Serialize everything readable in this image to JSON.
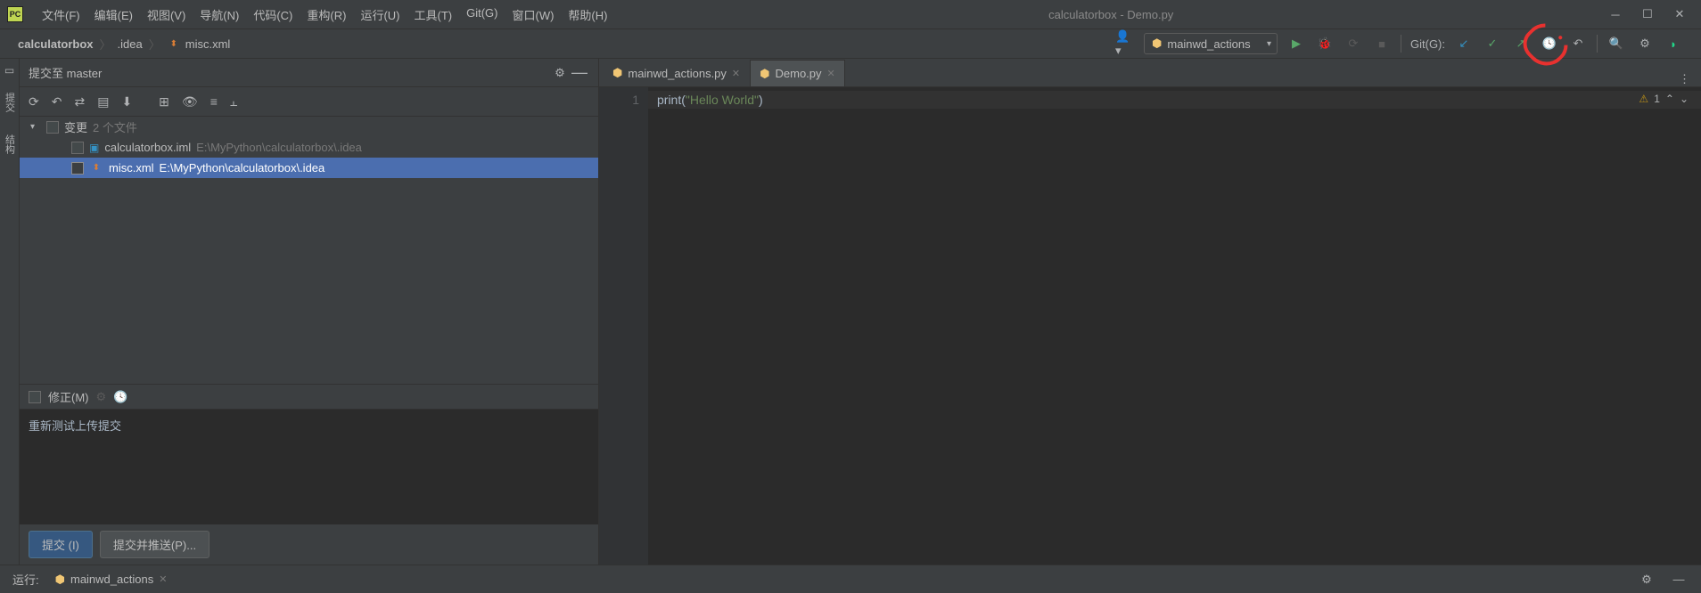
{
  "window": {
    "title": "calculatorbox - Demo.py"
  },
  "menu": {
    "items": [
      "文件(F)",
      "编辑(E)",
      "视图(V)",
      "导航(N)",
      "代码(C)",
      "重构(R)",
      "运行(U)",
      "工具(T)",
      "Git(G)",
      "窗口(W)",
      "帮助(H)"
    ]
  },
  "breadcrumb": {
    "project": "calculatorbox",
    "folder": ".idea",
    "file": "misc.xml"
  },
  "run_config": {
    "selected": "mainwd_actions",
    "git_label": "Git(G):"
  },
  "commit_panel": {
    "title": "提交至 master",
    "changes_label": "变更",
    "changes_count": "2 个文件",
    "files": [
      {
        "name": "calculatorbox.iml",
        "path": "E:\\MyPython\\calculatorbox\\.idea",
        "type": "iml",
        "selected": false
      },
      {
        "name": "misc.xml",
        "path": "E:\\MyPython\\calculatorbox\\.idea",
        "type": "xml",
        "selected": true
      }
    ],
    "amend_label": "修正(M)",
    "message": "重新测试上传提交",
    "commit_btn": "提交 (I)",
    "commit_push_btn": "提交并推送(P)..."
  },
  "editor": {
    "tabs": [
      {
        "name": "mainwd_actions.py",
        "active": false
      },
      {
        "name": "Demo.py",
        "active": true
      }
    ],
    "line_number": "1",
    "code_fn": "print",
    "code_par_open": "(",
    "code_str": "\"Hello World\"",
    "code_par_close": ")",
    "inspection_count": "1",
    "inspection_arrows": "⌃ ⌄"
  },
  "left_gutter": {
    "label1": "提交",
    "label2": "结构"
  },
  "statusbar": {
    "run_label": "运行:",
    "run_config": "mainwd_actions"
  }
}
